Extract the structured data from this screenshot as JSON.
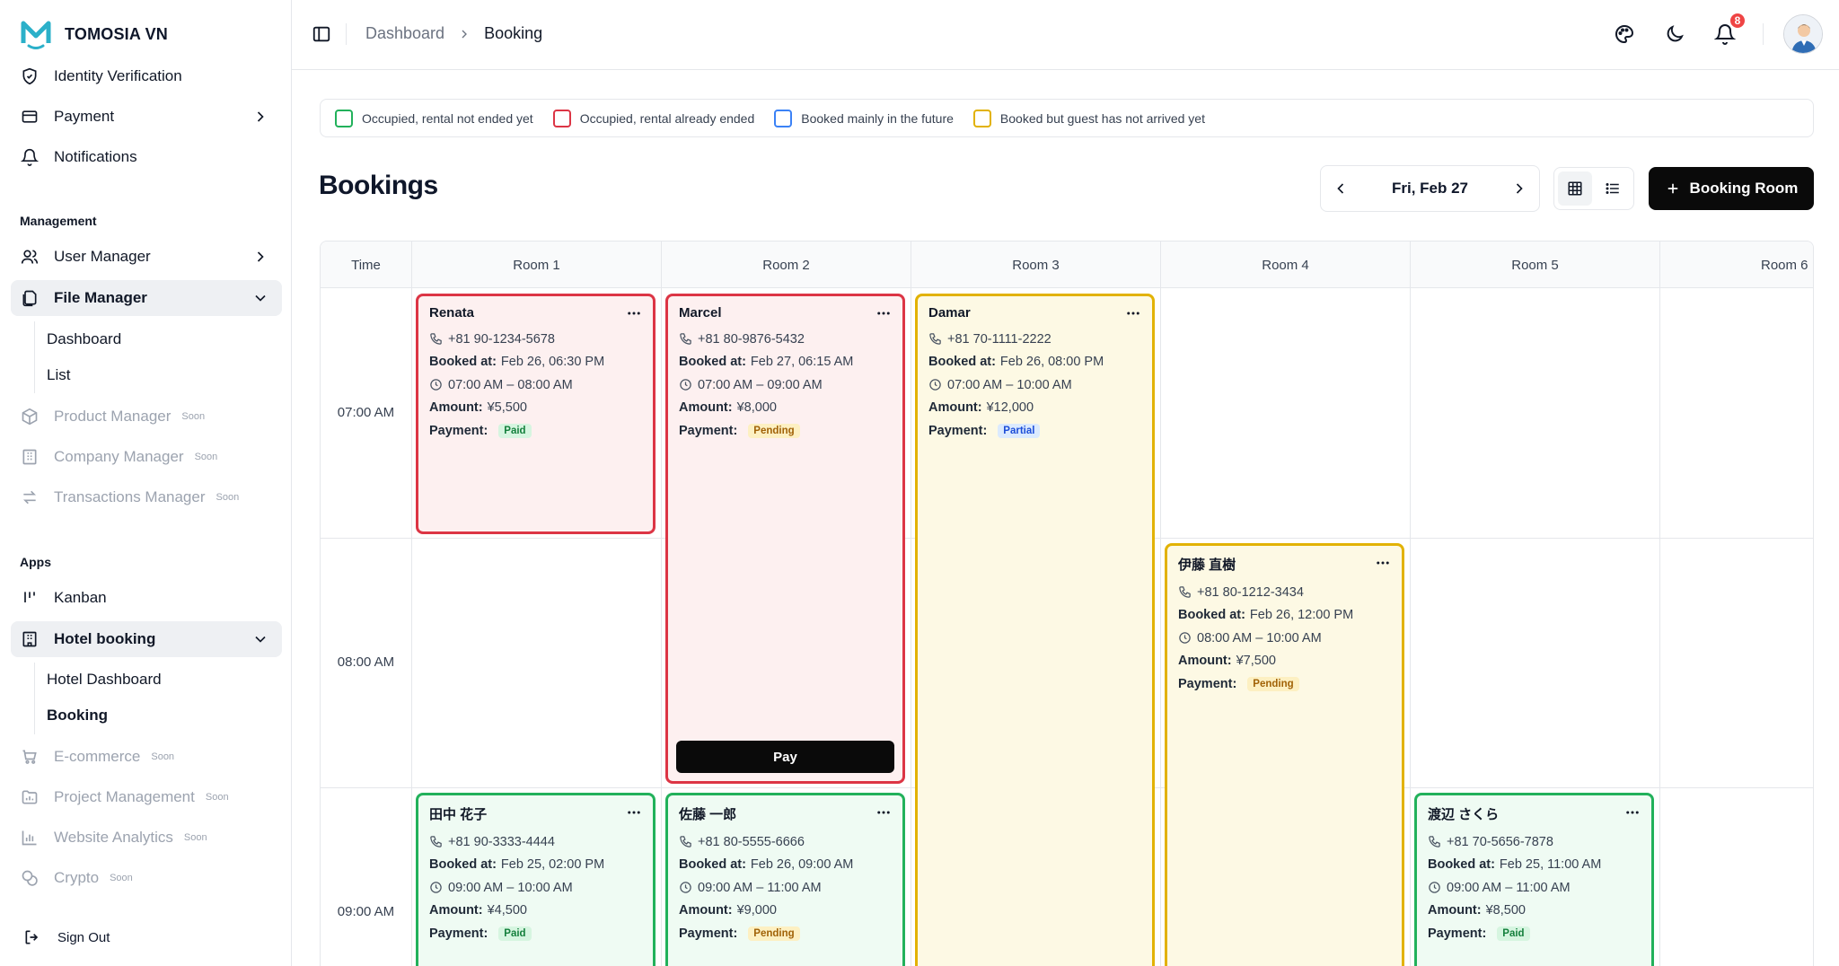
{
  "brand": {
    "name": "TOMOSIA VN"
  },
  "sidebar": {
    "items_top": [
      {
        "label": "Identity Verification",
        "icon": "shield-check-icon"
      },
      {
        "label": "Payment",
        "icon": "wallet-icon"
      },
      {
        "label": "Notifications",
        "icon": "bell-icon"
      }
    ],
    "management_label": "Management",
    "user_manager": "User Manager",
    "file_manager": "File Manager",
    "file_sub": [
      "Dashboard",
      "List"
    ],
    "product_manager": "Product Manager",
    "company_manager": "Company Manager",
    "transactions_manager": "Transactions Manager",
    "soon": "Soon",
    "apps_label": "Apps",
    "kanban": "Kanban",
    "hotel_booking": "Hotel booking",
    "hotel_sub": [
      "Hotel Dashboard",
      "Booking"
    ],
    "ecommerce": "E-commerce",
    "project_management": "Project Management",
    "website_analytics": "Website Analytics",
    "crypto": "Crypto",
    "sign_out": "Sign Out"
  },
  "topbar": {
    "breadcrumb": [
      "Dashboard",
      "Booking"
    ],
    "notification_count": "8"
  },
  "legend": [
    {
      "label": "Occupied, rental not ended yet",
      "color": "#22b15b"
    },
    {
      "label": "Occupied, rental already ended",
      "color": "#dc3545"
    },
    {
      "label": "Booked mainly in the future",
      "color": "#3b82f6"
    },
    {
      "label": "Booked but guest has not arrived yet",
      "color": "#e2b203"
    }
  ],
  "page": {
    "title": "Bookings",
    "date": "Fri, Feb 27",
    "book_button": "Booking Room"
  },
  "grid": {
    "time_header": "Time",
    "rooms": [
      "Room 1",
      "Room 2",
      "Room 3",
      "Room 4",
      "Room 5",
      "Room 6"
    ],
    "times": [
      "07:00 AM",
      "08:00 AM",
      "09:00 AM"
    ]
  },
  "labels": {
    "booked_at": "Booked at:",
    "amount": "Amount:",
    "payment": "Payment:",
    "pay": "Pay"
  },
  "bookings": [
    {
      "name": "Renata",
      "phone": "+81 90-1234-5678",
      "booked_at": "Feb 26, 06:30 PM",
      "time": "07:00 AM – 08:00 AM",
      "amount": "¥5,500",
      "payment": "Paid",
      "status": "red"
    },
    {
      "name": "Marcel",
      "phone": "+81 80-9876-5432",
      "booked_at": "Feb 27, 06:15 AM",
      "time": "07:00 AM – 09:00 AM",
      "amount": "¥8,000",
      "payment": "Pending",
      "status": "red"
    },
    {
      "name": "Damar",
      "phone": "+81 70-1111-2222",
      "booked_at": "Feb 26, 08:00 PM",
      "time": "07:00 AM – 10:00 AM",
      "amount": "¥12,000",
      "payment": "Partial",
      "status": "yellow"
    },
    {
      "name": "伊藤 直樹",
      "phone": "+81 80-1212-3434",
      "booked_at": "Feb 26, 12:00 PM",
      "time": "08:00 AM – 10:00 AM",
      "amount": "¥7,500",
      "payment": "Pending",
      "status": "yellow"
    },
    {
      "name": "田中 花子",
      "phone": "+81 90-3333-4444",
      "booked_at": "Feb 25, 02:00 PM",
      "time": "09:00 AM – 10:00 AM",
      "amount": "¥4,500",
      "payment": "Paid",
      "status": "green"
    },
    {
      "name": "佐藤 一郎",
      "phone": "+81 80-5555-6666",
      "booked_at": "Feb 26, 09:00 AM",
      "time": "09:00 AM – 11:00 AM",
      "amount": "¥9,000",
      "payment": "Pending",
      "status": "green"
    },
    {
      "name": "渡辺 さくら",
      "phone": "+81 70-5656-7878",
      "booked_at": "Feb 25, 11:00 AM",
      "time": "09:00 AM – 11:00 AM",
      "amount": "¥8,500",
      "payment": "Paid",
      "status": "green"
    }
  ]
}
